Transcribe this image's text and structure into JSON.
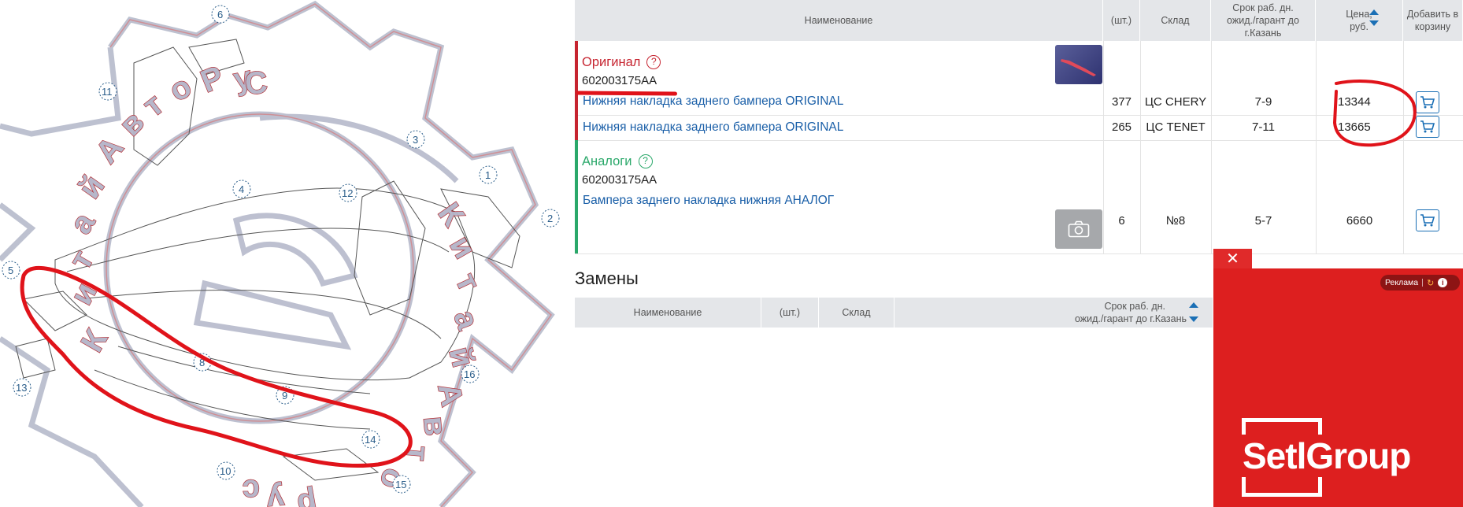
{
  "diagram": {
    "callouts": [
      "1",
      "2",
      "3",
      "4",
      "5",
      "6",
      "8",
      "9",
      "10",
      "11",
      "12",
      "13",
      "14",
      "15",
      "16"
    ],
    "watermark": "КитайАвто.рус"
  },
  "table": {
    "headers": {
      "name": "Наименование",
      "qty": "(шт.)",
      "warehouse": "Склад",
      "term": "Срок раб. дн. ожид./гарант до г.Казань",
      "price": "Цена, руб.",
      "add": "Добавить в корзину"
    },
    "original": {
      "title": "Оригинал",
      "help_icon": "?",
      "article": "602003175AA",
      "accent": "#c62430",
      "rows": [
        {
          "name": "Нижняя накладка заднего бампера ORIGINAL",
          "qty": "377",
          "warehouse": "ЦС CHERY",
          "term": "7-9",
          "price": "13344"
        },
        {
          "name": "Нижняя накладка заднего бампера ORIGINAL",
          "qty": "265",
          "warehouse": "ЦС TENET",
          "term": "7-11",
          "price": "13665"
        }
      ]
    },
    "analogs": {
      "title": "Аналоги",
      "help_icon": "?",
      "article": "602003175AA",
      "accent": "#2aa86a",
      "rows": [
        {
          "name": "Бампера заднего накладка нижняя АНАЛОГ",
          "qty": "6",
          "warehouse": "№8",
          "term": "5-7",
          "price": "6660"
        }
      ]
    }
  },
  "replacements": {
    "title": "Замены",
    "headers": {
      "name": "Наименование",
      "qty": "(шт.)",
      "warehouse": "Склад",
      "term_line1": "Срок раб. дн.",
      "term_line2": "ожид./гарант до г.Казань"
    }
  },
  "ad": {
    "close": "✕",
    "badge": "Реклама",
    "logo": "SetlGroup",
    "color": "#dd1f1f"
  },
  "icons": [
    "cart-icon",
    "camera-icon",
    "sort-up-icon",
    "sort-down-icon",
    "help-icon",
    "info-icon"
  ]
}
